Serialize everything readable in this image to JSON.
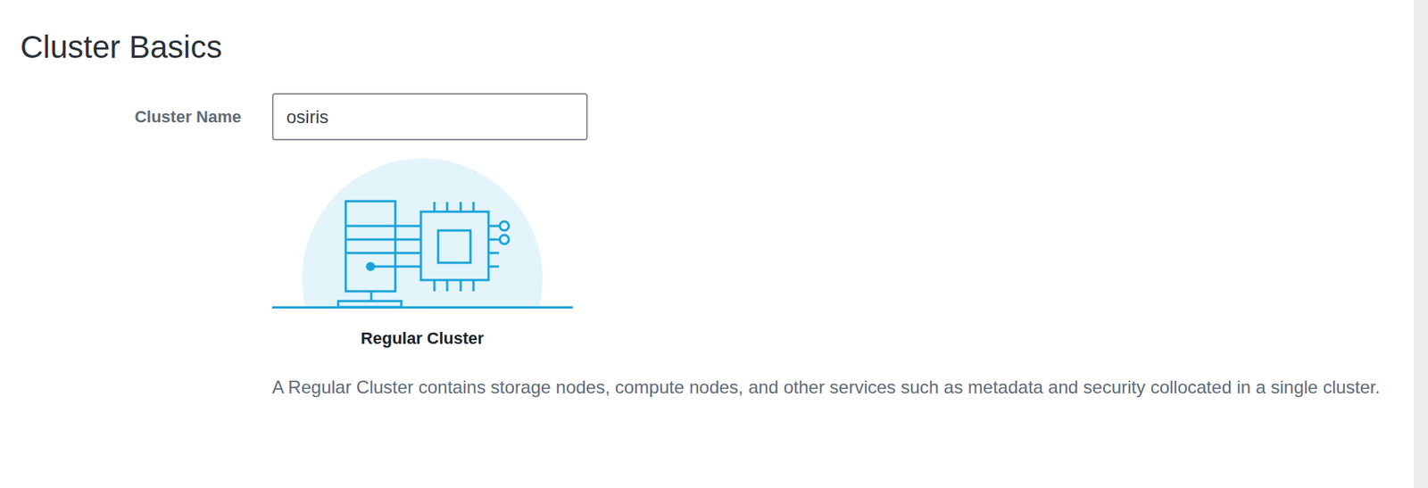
{
  "page": {
    "title": "Cluster Basics"
  },
  "cluster_name": {
    "label": "Cluster Name",
    "value": "osiris"
  },
  "cluster_type": {
    "label": "Regular Cluster",
    "description": "A Regular Cluster contains storage nodes, compute nodes, and other services such as metadata and security collocated in a single cluster."
  }
}
